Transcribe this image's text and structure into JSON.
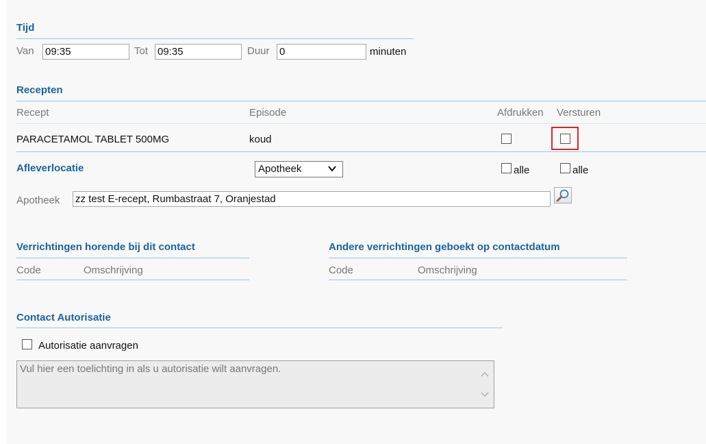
{
  "tijd": {
    "title": "Tijd",
    "van_label": "Van",
    "van_value": "09:35",
    "tot_label": "Tot",
    "tot_value": "09:35",
    "duur_label": "Duur",
    "duur_value": "0",
    "duur_unit": "minuten"
  },
  "recepten": {
    "title": "Recepten",
    "columns": [
      "Recept",
      "Episode",
      "Afdrukken",
      "Versturen"
    ],
    "rows": [
      {
        "recept": "PARACETAMOL TABLET 500MG",
        "episode": "koud",
        "afdrukken": false,
        "versturen": false
      }
    ]
  },
  "afleverlocatie": {
    "title": "Afleverlocatie",
    "select_value": "Apotheek",
    "afdrukken_all_label": "alle",
    "versturen_all_label": "alle",
    "apotheek_label": "Apotheek",
    "apotheek_value": "zz test E-recept, Rumbastraat 7, Oranjestad"
  },
  "verrichtingen": {
    "title": "Verrichtingen horende bij dit contact",
    "columns": [
      "Code",
      "Omschrijving"
    ]
  },
  "andere_verrichtingen": {
    "title": "Andere verrichtingen geboekt op contactdatum",
    "columns": [
      "Code",
      "Omschrijving"
    ]
  },
  "autorisatie": {
    "title": "Contact Autorisatie",
    "checkbox_label": "Autorisatie aanvragen",
    "checked": false,
    "textarea_placeholder": "Vul hier een toelichting in als u autorisatie wilt aanvragen."
  },
  "colors": {
    "section_title": "#1a64a0",
    "rule": "#9cc4e4",
    "highlight": "#e0242b",
    "panel_bg": "#f8f8f8"
  }
}
